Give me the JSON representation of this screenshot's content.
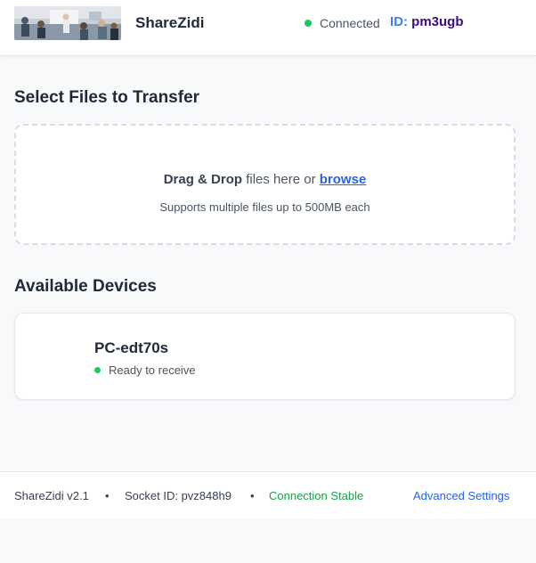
{
  "header": {
    "app_name": "ShareZidi",
    "status": "Connected",
    "id_label": "ID:",
    "id_value": "pm3ugb"
  },
  "transfer": {
    "heading": "Select Files to Transfer",
    "drop_bold": "Drag & Drop",
    "drop_text": " files here or ",
    "browse": "browse",
    "support_text": "Supports multiple files up to 500MB each"
  },
  "devices": {
    "heading": "Available Devices",
    "items": [
      {
        "name": "PC-edt70s",
        "status": "Ready to receive"
      }
    ]
  },
  "footer": {
    "version": "ShareZidi v2.1",
    "separator": "•",
    "socket": "Socket ID: pvz848h9",
    "connection": "Connection Stable",
    "advanced": "Advanced Settings"
  },
  "colors": {
    "accent": "#2563eb",
    "status_green": "#22c55e",
    "id_value": "#3b0a85"
  }
}
